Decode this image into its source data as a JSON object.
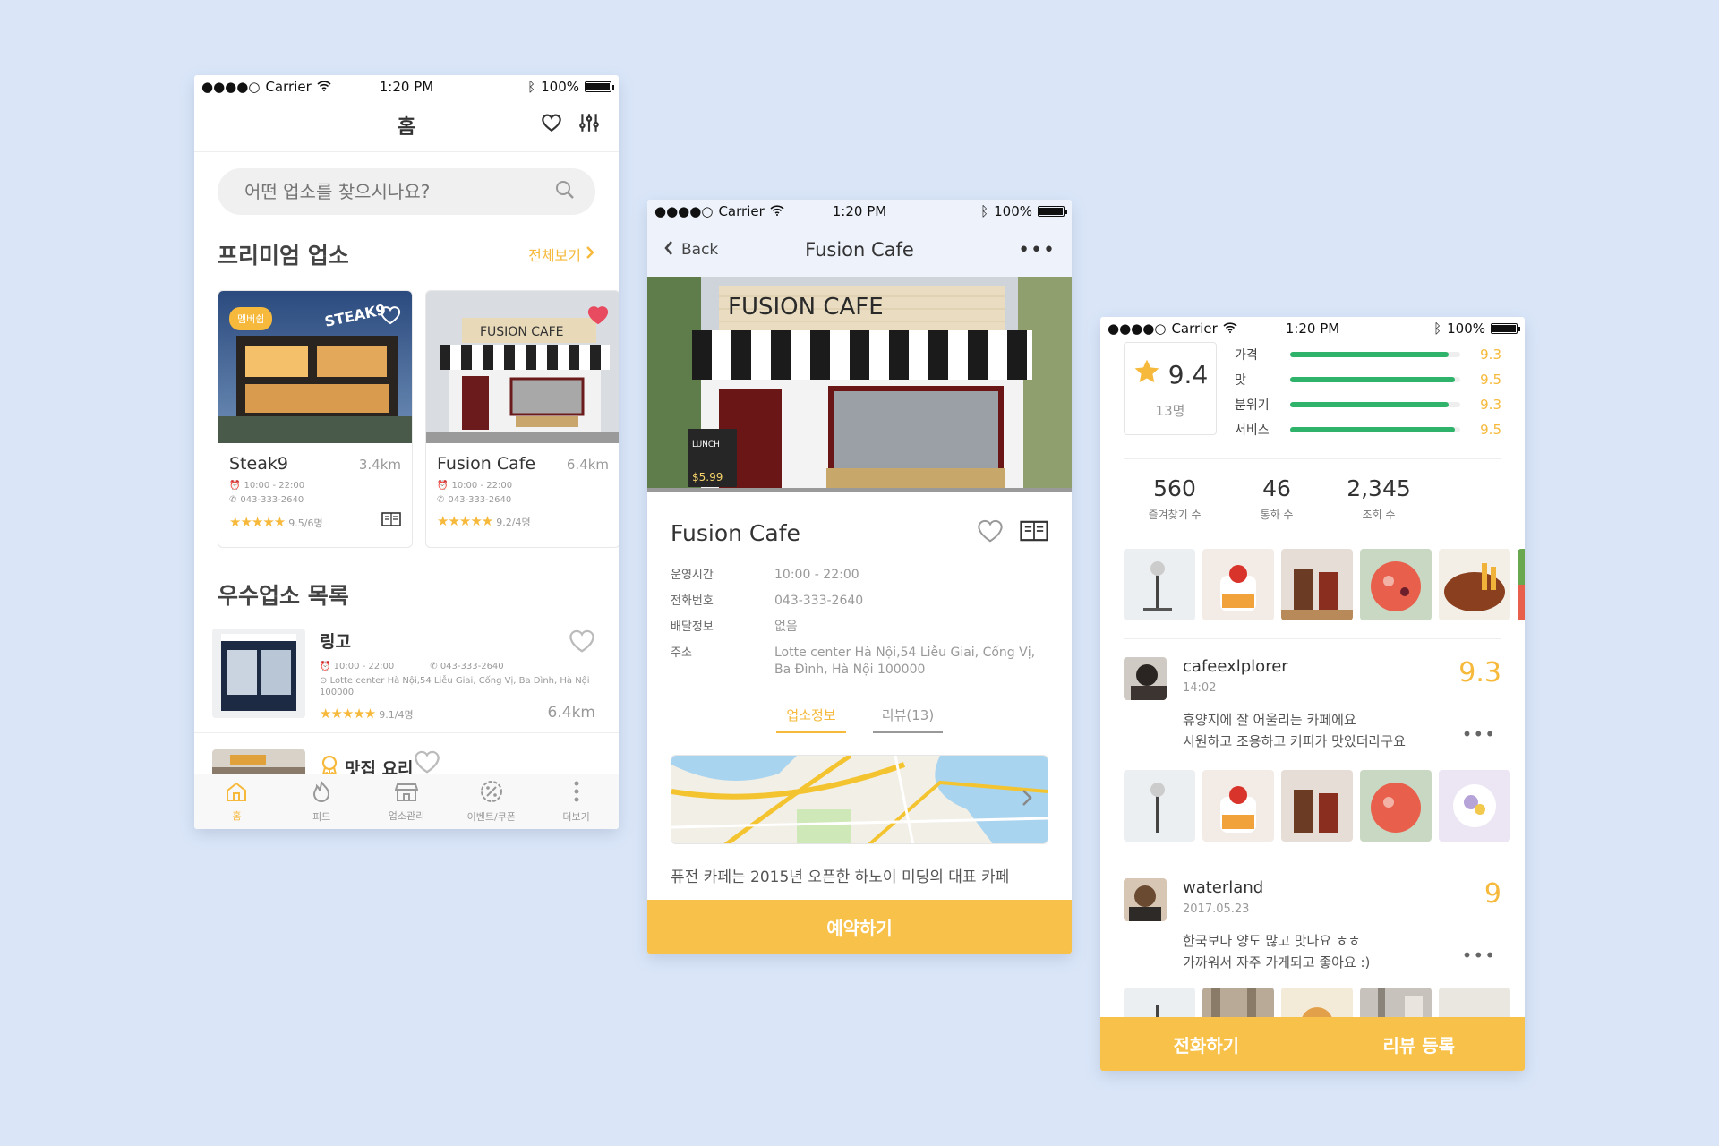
{
  "status": {
    "carrier": "Carrier",
    "time": "1:20 PM",
    "battery": "100%"
  },
  "home": {
    "title": "홈",
    "search_placeholder": "어떤 업소를 찾으시나요?",
    "premium_title": "프리미엄 업소",
    "see_all": "전체보기",
    "cards": [
      {
        "badge": "멤버쉽",
        "name": "Steak9",
        "dist": "3.4km",
        "hours": "10:00 - 22:00",
        "phone": "043-333-2640",
        "rating": "9.5/6명",
        "favorited": false
      },
      {
        "name": "Fusion Cafe",
        "dist": "6.4km",
        "hours": "10:00 - 22:00",
        "phone": "043-333-2640",
        "rating": "9.2/4명",
        "favorited": true
      }
    ],
    "best_title": "우수업소 목록",
    "list": [
      {
        "name": "링고",
        "hours": "10:00 - 22:00",
        "phone": "043-333-2640",
        "address": "Lotte center Hà Nội,54 Liễu Giai, Cống Vị, Ba Đình, Hà Nội  100000",
        "rating": "9.1/4명",
        "dist": "6.4km"
      },
      {
        "name": "맛집 요리"
      }
    ],
    "tabs": [
      {
        "label": "홈",
        "icon": "home-icon"
      },
      {
        "label": "피드",
        "icon": "fire-icon"
      },
      {
        "label": "업소관리",
        "icon": "store-icon"
      },
      {
        "label": "이벤트/쿠폰",
        "icon": "coupon-icon"
      },
      {
        "label": "더보기",
        "icon": "more-icon"
      }
    ]
  },
  "detail": {
    "back": "Back",
    "title": "Fusion Cafe",
    "name": "Fusion Cafe",
    "info": [
      {
        "k": "운영시간",
        "v": "10:00 - 22:00"
      },
      {
        "k": "전화번호",
        "v": "043-333-2640"
      },
      {
        "k": "배달정보",
        "v": "없음"
      },
      {
        "k": "주소",
        "v": "Lotte center Hà Nội,54 Liễu Giai, Cống Vị, Ba Đình, Hà Nội  100000"
      }
    ],
    "tab_info": "업소정보",
    "tab_review": "리뷰(13)",
    "description": "퓨전 카페는 2015년 오픈한 하노이 미딩의 대표 카페",
    "reserve": "예약하기"
  },
  "reviews": {
    "score": "9.4",
    "count": "13명",
    "categories": [
      {
        "label": "가격",
        "value": "9.3",
        "fraction": 0.93
      },
      {
        "label": "맛",
        "value": "9.5",
        "fraction": 0.97
      },
      {
        "label": "분위기",
        "value": "9.3",
        "fraction": 0.93
      },
      {
        "label": "서비스",
        "value": "9.5",
        "fraction": 0.97
      }
    ],
    "stats": [
      {
        "n": "560",
        "l": "즐겨찾기 수"
      },
      {
        "n": "46",
        "l": "통화 수"
      },
      {
        "n": "2,345",
        "l": "조회 수"
      }
    ],
    "items": [
      {
        "user": "cafeexlplorer",
        "date": "14:02",
        "score": "9.3",
        "text1": "휴양지에 잘 어울리는 카페에요",
        "text2": "시원하고 조용하고 커피가 맛있더라구요"
      },
      {
        "user": "waterland",
        "date": "2017.05.23",
        "score": "9",
        "text1": "한국보다 양도 많고 맛나요 ㅎㅎ",
        "text2": "가까워서 자주 가게되고 좋아요 :)"
      }
    ],
    "call": "전화하기",
    "write": "리뷰 등록"
  },
  "colors": {
    "accent": "#f6b93b",
    "cta": "#f8c14a",
    "bar": "#2fb36a",
    "background": "#dae6f8"
  }
}
